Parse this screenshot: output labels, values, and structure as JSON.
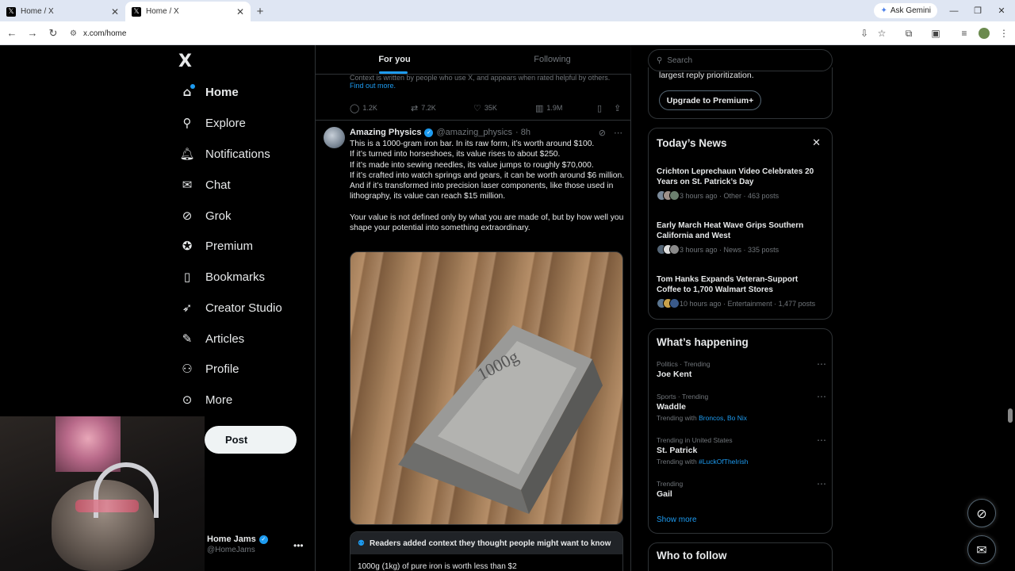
{
  "browser": {
    "tabs": [
      {
        "title": "Home / X",
        "favicon": "x-logo"
      },
      {
        "title": "Home / X",
        "favicon": "x-logo",
        "active": true
      }
    ],
    "ask_gemini": "Ask Gemini",
    "url": "x.com/home"
  },
  "nav": {
    "logo": "X",
    "items": [
      {
        "label": "Home",
        "icon": "home-icon"
      },
      {
        "label": "Explore",
        "icon": "search-icon"
      },
      {
        "label": "Notifications",
        "icon": "bell-icon"
      },
      {
        "label": "Chat",
        "icon": "mail-icon"
      },
      {
        "label": "Grok",
        "icon": "grok-icon"
      },
      {
        "label": "Premium",
        "icon": "premium-icon"
      },
      {
        "label": "Bookmarks",
        "icon": "bookmark-icon"
      },
      {
        "label": "Creator Studio",
        "icon": "rocket-icon"
      },
      {
        "label": "Articles",
        "icon": "articles-icon"
      },
      {
        "label": "Profile",
        "icon": "person-icon"
      },
      {
        "label": "More",
        "icon": "more-circle-icon"
      }
    ],
    "post_label": "Post",
    "account": {
      "name": "Home Jams",
      "handle": "@HomeJams"
    }
  },
  "timeline": {
    "tabs": [
      "For you",
      "Following"
    ],
    "prev_note_text": "Context is written by people who use X, and appears when rated helpful by others.",
    "prev_note_link": "Find out more.",
    "prev_stats": {
      "replies": "1.2K",
      "reposts": "7.2K",
      "likes": "35K",
      "views": "1.9M"
    },
    "tweet": {
      "name": "Amazing Physics",
      "handle": "@amazing_physics",
      "time": "· 8h",
      "lines": [
        "This is a 1000-gram iron bar. In its raw form, it’s worth around $100.",
        "If it’s turned into horseshoes, its value rises to about $250.",
        "If it’s made into sewing needles, its value jumps to roughly $70,000.",
        "If it’s crafted into watch springs and gears, it can be worth around $6 million.",
        "And if it’s transformed into precision laser components, like those used in lithography, its value can reach $15 million."
      ],
      "closing": "Your value is not defined only by what you are made of, but by how well you shape your potential into something extraordinary.",
      "image_text": "1000g",
      "context_header": "Readers added context they thought people might want to know",
      "context_body": "1000g (1kg) of pure iron is worth less than $2"
    }
  },
  "sidebar": {
    "search_placeholder": "Search",
    "premium_text": "largest reply prioritization.",
    "premium_button": "Upgrade to Premium+",
    "news_title": "Today’s News",
    "news": [
      {
        "title": "Crichton Leprechaun Video Celebrates 20 Years on St. Patrick’s Day",
        "meta": "3 hours ago · Other · 463 posts"
      },
      {
        "title": "Early March Heat Wave Grips Southern California and West",
        "meta": "3 hours ago · News · 335 posts"
      },
      {
        "title": "Tom Hanks Expands Veteran-Support Coffee to 1,700 Walmart Stores",
        "meta": "10 hours ago · Entertainment · 1,477 posts"
      }
    ],
    "happening_title": "What’s happening",
    "trends": [
      {
        "category": "Politics · Trending",
        "name": "Joe Kent",
        "with_label": "",
        "with_links": ""
      },
      {
        "category": "Sports · Trending",
        "name": "Waddle",
        "with_label": "Trending with",
        "with_links": "Broncos, Bo Nix"
      },
      {
        "category": "Trending in United States",
        "name": "St. Patrick",
        "with_label": "Trending with",
        "with_links": "#LuckOfTheIrish"
      },
      {
        "category": "Trending",
        "name": "Gail",
        "with_label": "",
        "with_links": ""
      }
    ],
    "show_more": "Show more",
    "who_to_follow": "Who to follow"
  },
  "colors": {
    "accent": "#1d9bf0",
    "background": "#000000",
    "border": "#2f3336",
    "muted": "#71767b"
  }
}
